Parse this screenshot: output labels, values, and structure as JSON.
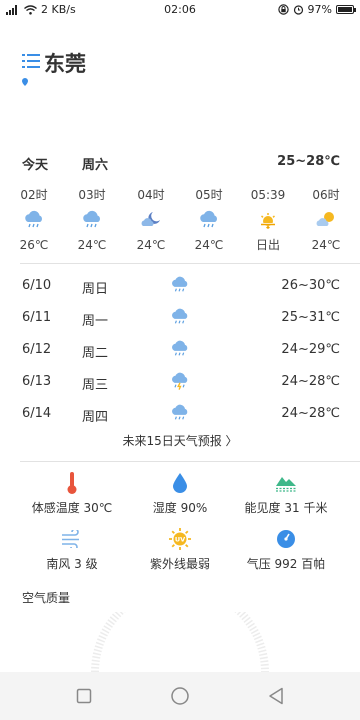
{
  "status_bar": {
    "signal": "4G",
    "speed": "2 KB/s",
    "time": "02:06",
    "battery": "97%"
  },
  "header": {
    "city": "东莞"
  },
  "today": {
    "day": "今天",
    "weekday": "周六",
    "range": "25~28℃"
  },
  "hourly": [
    {
      "time": "02时",
      "icon": "rain-cloud-icon",
      "value": "26℃"
    },
    {
      "time": "03时",
      "icon": "rain-cloud-icon",
      "value": "24℃"
    },
    {
      "time": "04时",
      "icon": "moon-cloud-icon",
      "value": "24℃"
    },
    {
      "time": "05时",
      "icon": "rain-cloud-icon",
      "value": "24℃"
    },
    {
      "time": "05:39",
      "icon": "sunrise-icon",
      "value": "日出"
    },
    {
      "time": "06时",
      "icon": "sun-cloud-icon",
      "value": "24℃"
    }
  ],
  "daily": [
    {
      "date": "6/10",
      "weekday": "周日",
      "icon": "rain-cloud-icon",
      "range": "26~30℃"
    },
    {
      "date": "6/11",
      "weekday": "周一",
      "icon": "rain-cloud-icon",
      "range": "25~31℃"
    },
    {
      "date": "6/12",
      "weekday": "周二",
      "icon": "rain-cloud-icon",
      "range": "24~29℃"
    },
    {
      "date": "6/13",
      "weekday": "周三",
      "icon": "thunder-rain-icon",
      "range": "24~28℃"
    },
    {
      "date": "6/14",
      "weekday": "周四",
      "icon": "rain-cloud-icon",
      "range": "24~28℃"
    }
  ],
  "forecast_link": "未来15日天气预报 〉",
  "details": [
    {
      "icon": "thermometer-icon",
      "label": "体感温度 30℃"
    },
    {
      "icon": "humidity-drop-icon",
      "label": "湿度 90%"
    },
    {
      "icon": "visibility-mountain-icon",
      "label": "能见度 31 千米"
    },
    {
      "icon": "wind-icon",
      "label": "南风 3 级"
    },
    {
      "icon": "uv-sun-icon",
      "label": "紫外线最弱",
      "badge": "UV"
    },
    {
      "icon": "pressure-gauge-icon",
      "label": "气压 992 百帕"
    }
  ],
  "air_quality": {
    "title": "空气质量"
  },
  "colors": {
    "accent": "#3a8ee6",
    "sun": "#f5b821",
    "thermo": "#e8553c",
    "mountain": "#3fb88a"
  }
}
